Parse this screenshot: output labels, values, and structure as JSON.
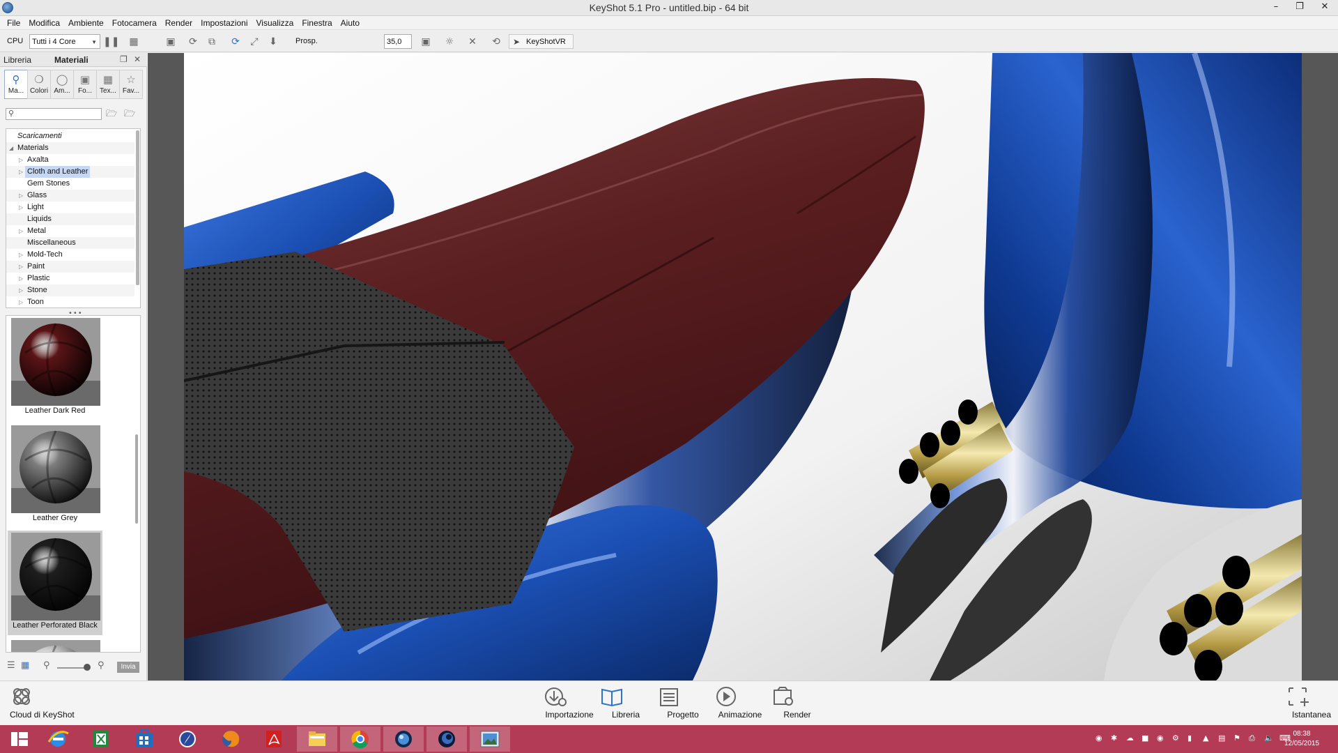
{
  "window": {
    "title": "KeyShot 5.1 Pro  - untitled.bip  - 64 bit",
    "minimize_icon": "minimize-icon",
    "maximize_icon": "restore-icon",
    "close_icon": "close-icon"
  },
  "menu": [
    "File",
    "Modifica",
    "Ambiente",
    "Fotocamera",
    "Render",
    "Impostazioni",
    "Visualizza",
    "Finestra",
    "Aiuto"
  ],
  "toolbar": {
    "cpu_label": "CPU",
    "cores_value": "Tutti i 4 Core",
    "perspective_label": "Prosp.",
    "fov_value": "35,0",
    "keyshotvr_label": "KeyShotVR"
  },
  "panel": {
    "tab_library": "Libreria",
    "tab_materials": "Materiali",
    "categories": [
      {
        "label": "Ma...",
        "icon": "search-icon"
      },
      {
        "label": "Colori",
        "icon": "palette-icon"
      },
      {
        "label": "Am...",
        "icon": "globe-icon"
      },
      {
        "label": "Fo...",
        "icon": "image-icon"
      },
      {
        "label": "Tex...",
        "icon": "texture-icon"
      },
      {
        "label": "Fav...",
        "icon": "star-icon"
      }
    ],
    "search_placeholder": "",
    "tree": [
      {
        "label": "Scaricamenti",
        "level": 0,
        "expander": "",
        "italic": true
      },
      {
        "label": "Materials",
        "level": 0,
        "expander": "open"
      },
      {
        "label": "Axalta",
        "level": 1,
        "expander": "closed"
      },
      {
        "label": "Cloth and Leather",
        "level": 1,
        "expander": "closed",
        "selected": true
      },
      {
        "label": "Gem Stones",
        "level": 1,
        "expander": ""
      },
      {
        "label": "Glass",
        "level": 1,
        "expander": "closed"
      },
      {
        "label": "Light",
        "level": 1,
        "expander": "closed"
      },
      {
        "label": "Liquids",
        "level": 1,
        "expander": ""
      },
      {
        "label": "Metal",
        "level": 1,
        "expander": "closed"
      },
      {
        "label": "Miscellaneous",
        "level": 1,
        "expander": ""
      },
      {
        "label": "Mold-Tech",
        "level": 1,
        "expander": "closed"
      },
      {
        "label": "Paint",
        "level": 1,
        "expander": "closed"
      },
      {
        "label": "Plastic",
        "level": 1,
        "expander": "closed"
      },
      {
        "label": "Stone",
        "level": 1,
        "expander": "closed"
      },
      {
        "label": "Toon",
        "level": 1,
        "expander": "closed"
      }
    ],
    "thumbnails": [
      {
        "name": "Leather Dark Red",
        "color": "#5a1416"
      },
      {
        "name": "Leather Grey",
        "color": "#7d7d7d"
      },
      {
        "name": "Leather Perforated Black",
        "color": "#1e1e1e",
        "selected": true
      },
      {
        "name": "",
        "color": "#e0e0e0"
      }
    ],
    "send_label": "Invia"
  },
  "ribbon": {
    "cloud_label": "Cloud di KeyShot",
    "buttons": [
      {
        "label": "Importazione",
        "icon": "import-icon"
      },
      {
        "label": "Libreria",
        "icon": "library-book-icon"
      },
      {
        "label": "Progetto",
        "icon": "project-icon"
      },
      {
        "label": "Animazione",
        "icon": "animation-play-icon"
      },
      {
        "label": "Render",
        "icon": "render-icon"
      }
    ],
    "snapshot_label": "Istantanea"
  },
  "taskbar": {
    "apps": [
      "show-desktop-icon",
      "internet-explorer-icon",
      "excel-icon",
      "store-icon",
      "compass-icon",
      "firefox-icon",
      "acrobat-icon",
      "file-explorer-icon",
      "chrome-icon",
      "keyshot-icon",
      "cinema4d-icon",
      "photo-viewer-icon"
    ],
    "time": "08:38",
    "date": "12/05/2015"
  },
  "colors": {
    "taskbar": "#b43b56",
    "accent": "#2f73c9",
    "seat_leather": "#5a1a1c",
    "metal_blue": "#1b4fb3"
  }
}
